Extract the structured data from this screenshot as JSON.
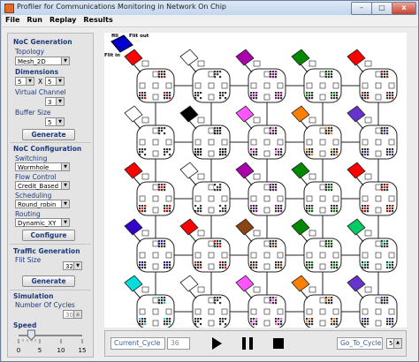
{
  "window": {
    "title": "Profiler for Communications Monitoring in Network On Chip",
    "minimize": "–",
    "maximize": "□",
    "close": "x"
  },
  "menu": [
    "File",
    "Run",
    "Replay",
    "Results"
  ],
  "noc_generation": {
    "title": "NoC Generation",
    "topology_label": "Topology",
    "topology_value": "Mesh_2D",
    "dimensions_label": "Dimensions",
    "dim_x": "5",
    "dim_sep": "X",
    "dim_y": "5",
    "virtual_channel_label": "Virtual Channel",
    "virtual_channel_value": "3",
    "buffer_size_label": "Buffer Size",
    "buffer_size_value": "5",
    "generate_label": "Generate"
  },
  "noc_configuration": {
    "title": "NoC Configuration",
    "switching_label": "Switching",
    "switching_value": "Wormhole",
    "flow_control_label": "Flow Control",
    "flow_control_value": "Credit_Based",
    "scheduling_label": "Scheduling",
    "scheduling_value": "Round_robin",
    "routing_label": "Routing",
    "routing_value": "Dynamic_XY",
    "configure_label": "Configure"
  },
  "traffic_generation": {
    "title": "Traffic Generation",
    "flit_size_label": "Flit Size",
    "flit_size_value": "32",
    "generate_label": "Generate"
  },
  "simulation": {
    "title": "Simulation",
    "cycles_label": "Number Of Cycles",
    "cycles_value": "300",
    "speed_label": "Speed",
    "speed_value": 3,
    "speed_ticks": [
      "0",
      "5",
      "10",
      "15"
    ]
  },
  "legend": {
    "flit_in_top": "fill",
    "flit_out": "Flit out",
    "flit_in": "Flit in"
  },
  "playback": {
    "current_cycle_label": "Current_Cycle",
    "current_cycle_value": "36",
    "goto_label": "Go_To_Cycle",
    "goto_value": "5"
  },
  "mesh": {
    "rows": 5,
    "cols": 5,
    "router_colors": [
      [
        "#ff0000",
        "#ffffff",
        "#aa00aa",
        "#008800",
        "#ff0000"
      ],
      [
        "#ffffff",
        "#000000",
        "#ff55ff",
        "#ff7f00",
        "#6633cc"
      ],
      [
        "#ff0000",
        "#ffffff",
        "#aa00aa",
        "#008800",
        "#ff0000"
      ],
      [
        "#3300cc",
        "#ff0000",
        "#8b4513",
        "#008800",
        "#00cc66"
      ],
      [
        "#00dddd",
        "#ffffff",
        "#ff55ff",
        "#ff7f00",
        "#6633cc"
      ]
    ],
    "legend_color": "#0000cc"
  }
}
